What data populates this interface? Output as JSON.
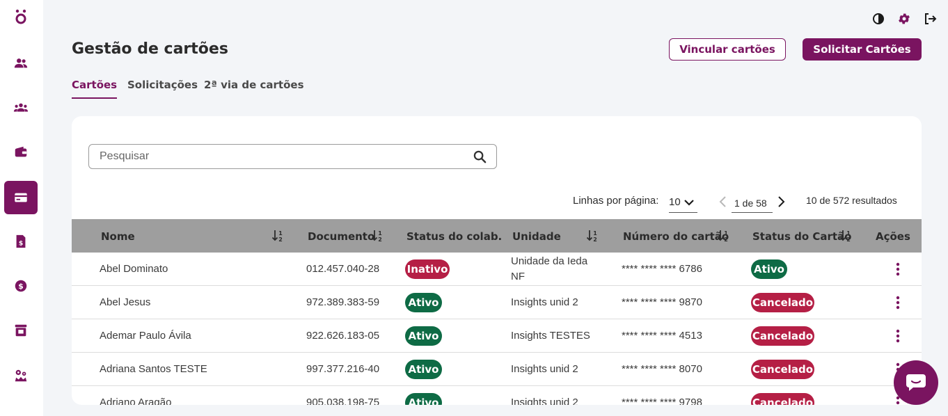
{
  "header": {
    "title": "Gestão de cartões",
    "link_button": "Vincular cartões",
    "request_button": "Solicitar Cartões"
  },
  "tabs": [
    {
      "label": "Cartões",
      "active": true
    },
    {
      "label": "Solicitações",
      "active": false
    },
    {
      "label": "2ª via de cartões",
      "active": false
    }
  ],
  "search": {
    "placeholder": "Pesquisar",
    "value": ""
  },
  "pagination": {
    "rows_label": "Linhas por página:",
    "rows_value": "10",
    "page_text": "1 de 58",
    "results_text": "10 de 572 resultados"
  },
  "table": {
    "columns": [
      "Nome",
      "Documento",
      "Status do colab.",
      "Unidade",
      "Número do cartão",
      "Status do Cartão",
      "Ações"
    ],
    "rows": [
      {
        "name": "Abel Dominato",
        "document": "012.457.040-28",
        "collab_status": "Inativo",
        "unit_line1": "Unidade da Ieda",
        "unit_line2": "NF",
        "card": "**** **** **** 6786",
        "card_status": "Ativo"
      },
      {
        "name": "Abel Jesus",
        "document": "972.389.383-59",
        "collab_status": "Ativo",
        "unit_line1": "Insights unid 2",
        "unit_line2": "",
        "card": "**** **** **** 9870",
        "card_status": "Cancelado"
      },
      {
        "name": "Ademar Paulo Ávila",
        "document": "922.626.183-05",
        "collab_status": "Ativo",
        "unit_line1": "Insights TESTES",
        "unit_line2": "",
        "card": "**** **** **** 4513",
        "card_status": "Cancelado"
      },
      {
        "name": "Adriana Santos TESTE",
        "document": "997.377.216-40",
        "collab_status": "Ativo",
        "unit_line1": "Insights unid 2",
        "unit_line2": "",
        "card": "**** **** **** 8070",
        "card_status": "Cancelado"
      },
      {
        "name": "Adriano Aragão",
        "document": "905.038.198-75",
        "collab_status": "Ativo",
        "unit_line1": "Insights unid 2",
        "unit_line2": "",
        "card": "**** **** **** 9798",
        "card_status": "Cancelado"
      }
    ]
  },
  "colors": {
    "brand": "#7a1460",
    "active_badge": "#0e6b45",
    "inactive_badge": "#b51f45",
    "header_bg": "#9e9e9e"
  },
  "icons": {
    "sidebar": [
      "people-icon",
      "group-icon",
      "wallet-icon",
      "card-icon",
      "document-dollar-icon",
      "dollar-coin-icon",
      "store-icon",
      "settings-crown-icon"
    ],
    "top": [
      "contrast-icon",
      "gear-icon",
      "logout-icon"
    ]
  }
}
